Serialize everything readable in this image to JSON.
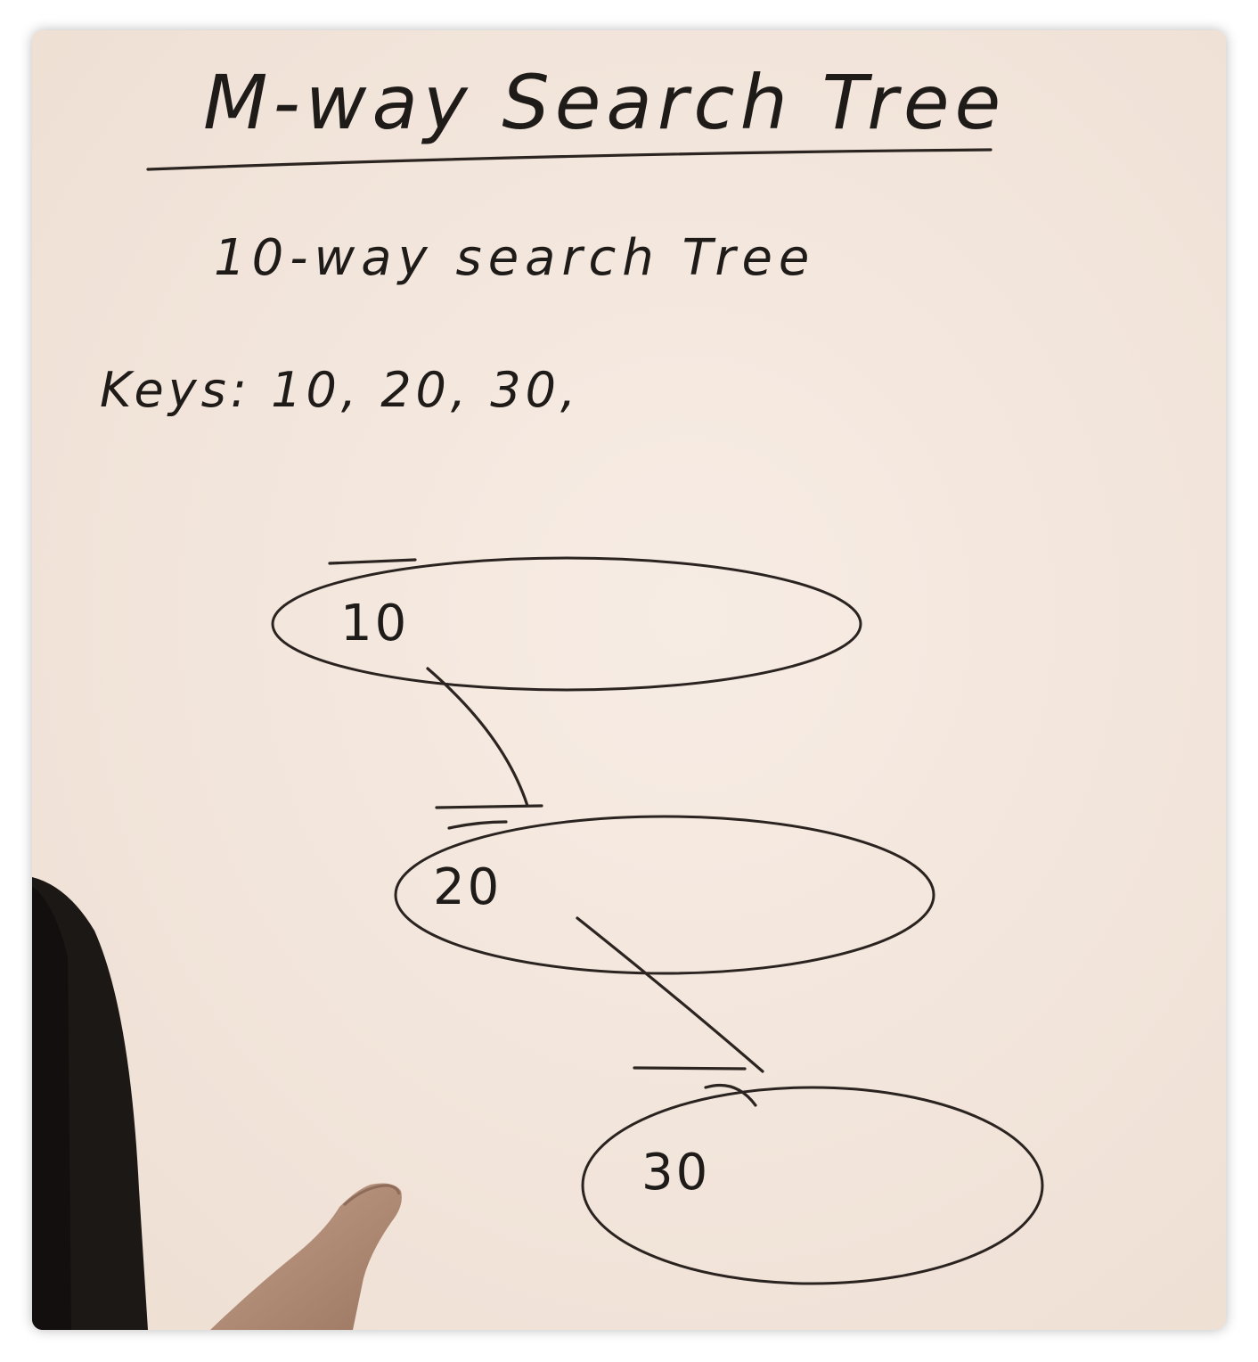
{
  "board": {
    "title": "M-way Search Tree",
    "subtitle": "10-way search Tree",
    "keys_line": "Keys: 10, 20, 30,"
  },
  "tree": {
    "nodes": [
      {
        "key": "10"
      },
      {
        "key": "20"
      },
      {
        "key": "30"
      }
    ]
  },
  "colors": {
    "board": "#f3e6dc",
    "ink": "#1e1b19",
    "presenter_shirt": "#1c1816",
    "presenter_hand": "#b08c77"
  }
}
